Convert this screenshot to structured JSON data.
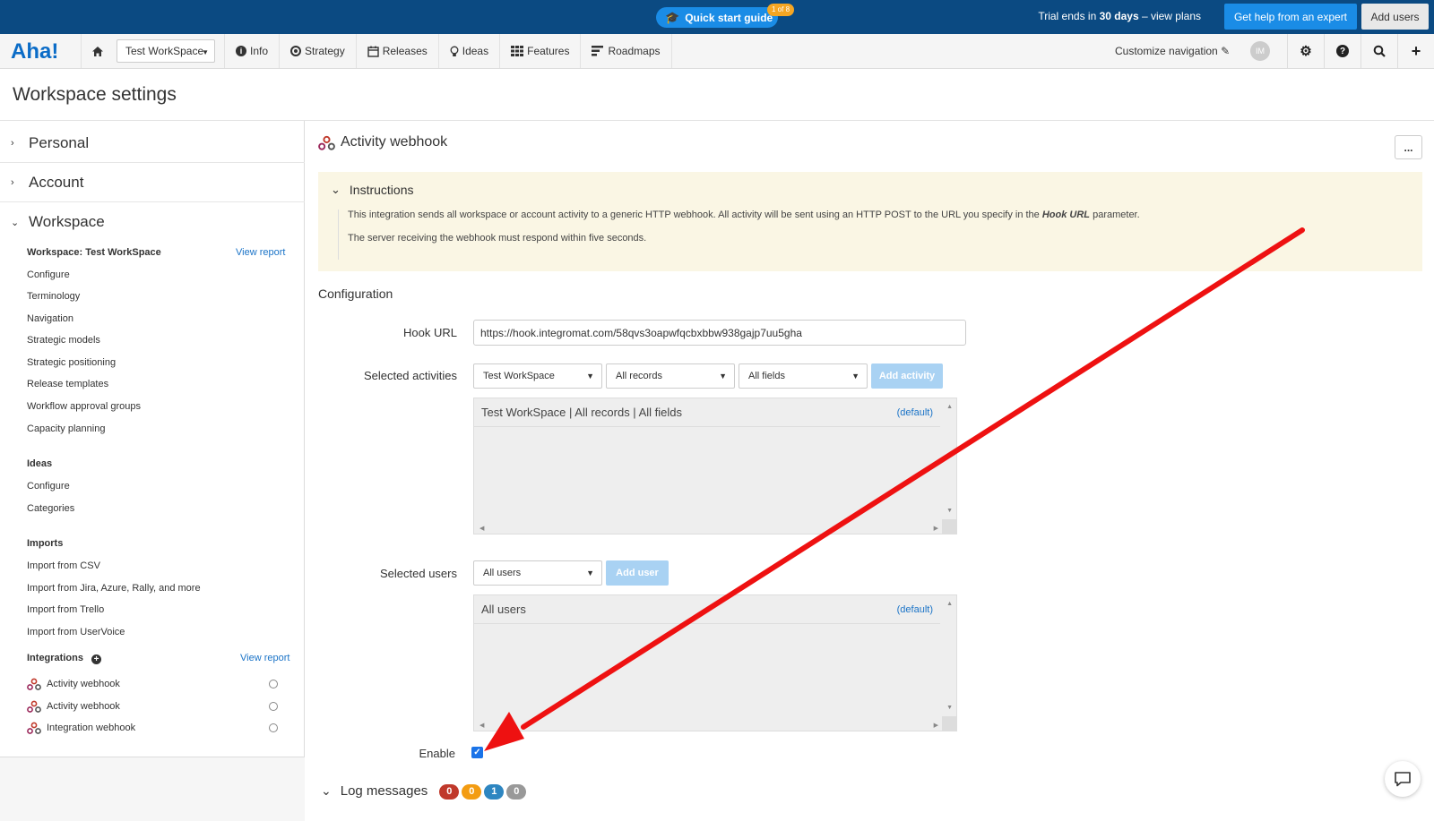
{
  "topbar": {
    "quick_start": "Quick start guide",
    "quick_start_badge": "1 of 8",
    "trial_prefix": "Trial ends in ",
    "trial_days": "30 days",
    "trial_suffix": " – view plans",
    "help_button": "Get help from an expert",
    "add_users_button": "Add users"
  },
  "nav": {
    "logo": "Aha!",
    "workspace_select": "Test WorkSpace",
    "items": [
      "Info",
      "Strategy",
      "Releases",
      "Ideas",
      "Features",
      "Roadmaps"
    ],
    "customize": "Customize navigation",
    "avatar_initials": "IM"
  },
  "page": {
    "title": "Workspace settings"
  },
  "sidebar": {
    "personal": "Personal",
    "account": "Account",
    "workspace": "Workspace",
    "workspace_group": "Workspace: Test WorkSpace",
    "view_report": "View report",
    "workspace_links": [
      "Configure",
      "Terminology",
      "Navigation",
      "Strategic models",
      "Strategic positioning",
      "Release templates",
      "Workflow approval groups",
      "Capacity planning"
    ],
    "ideas_group": "Ideas",
    "ideas_links": [
      "Configure",
      "Categories"
    ],
    "imports_group": "Imports",
    "imports_links": [
      "Import from CSV",
      "Import from Jira, Azure, Rally, and more",
      "Import from Trello",
      "Import from UserVoice"
    ],
    "integrations_group": "Integrations",
    "integrations_report": "View report",
    "integrations": [
      "Activity webhook",
      "Activity webhook",
      "Integration webhook"
    ]
  },
  "main": {
    "title": "Activity webhook",
    "more": "...",
    "instructions_title": "Instructions",
    "instr_p1_a": "This integration sends all workspace or account activity to a generic HTTP webhook. All activity will be sent using an HTTP POST to the URL you specify in the ",
    "instr_p1_b": "Hook URL",
    "instr_p1_c": " parameter.",
    "instr_p2": "The server receiving the webhook must respond within five seconds.",
    "config_title": "Configuration",
    "hook_url_label": "Hook URL",
    "hook_url_value": "https://hook.integromat.com/58qvs3oapwfqcbxbbw938gajp7uu5gha",
    "activities_label": "Selected activities",
    "act_workspace": "Test WorkSpace",
    "act_records": "All records",
    "act_fields": "All fields",
    "add_activity": "Add activity",
    "activity_row": "Test WorkSpace | All records | All fields",
    "default_tag": "(default)",
    "users_label": "Selected users",
    "users_select": "All users",
    "add_user": "Add user",
    "users_row": "All users",
    "enable_label": "Enable",
    "enable_checked": true,
    "log_title": "Log messages",
    "log_counts": [
      {
        "value": "0",
        "color": "#c0392b"
      },
      {
        "value": "0",
        "color": "#f39c12"
      },
      {
        "value": "1",
        "color": "#2e86c1"
      },
      {
        "value": "0",
        "color": "#999999"
      }
    ]
  },
  "colors": {
    "topbar": "#0b4a82",
    "accent": "#1a8ce6",
    "link": "#1a73c7",
    "instructions_bg": "#faf6e4",
    "annotation_arrow": "#ee1111"
  }
}
